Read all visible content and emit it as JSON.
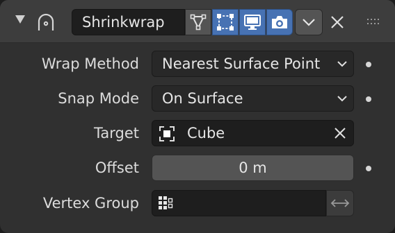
{
  "header": {
    "modifier_name": "Shrinkwrap",
    "icons": {
      "collapse": "collapse-arrow-icon",
      "modifier": "shrinkwrap-icon",
      "edit_mode": "edit-mode-icon",
      "on_cage": "on-cage-icon",
      "realtime": "viewport-display-icon",
      "render": "render-camera-icon",
      "menu": "chevron-down-icon",
      "delete": "close-icon",
      "drag": "drag-grip-icon"
    }
  },
  "fields": {
    "wrap_method": {
      "label": "Wrap Method",
      "value": "Nearest Surface Point"
    },
    "snap_mode": {
      "label": "Snap Mode",
      "value": "On Surface"
    },
    "target": {
      "label": "Target",
      "value": "Cube"
    },
    "offset": {
      "label": "Offset",
      "value": "0 m"
    },
    "vertex_group": {
      "label": "Vertex Group",
      "value": ""
    }
  },
  "colors": {
    "accent": "#4772b3",
    "panel": "#303030",
    "header": "#3d3d3d",
    "field_dark": "#1e1e1e",
    "field_mid": "#545454"
  }
}
